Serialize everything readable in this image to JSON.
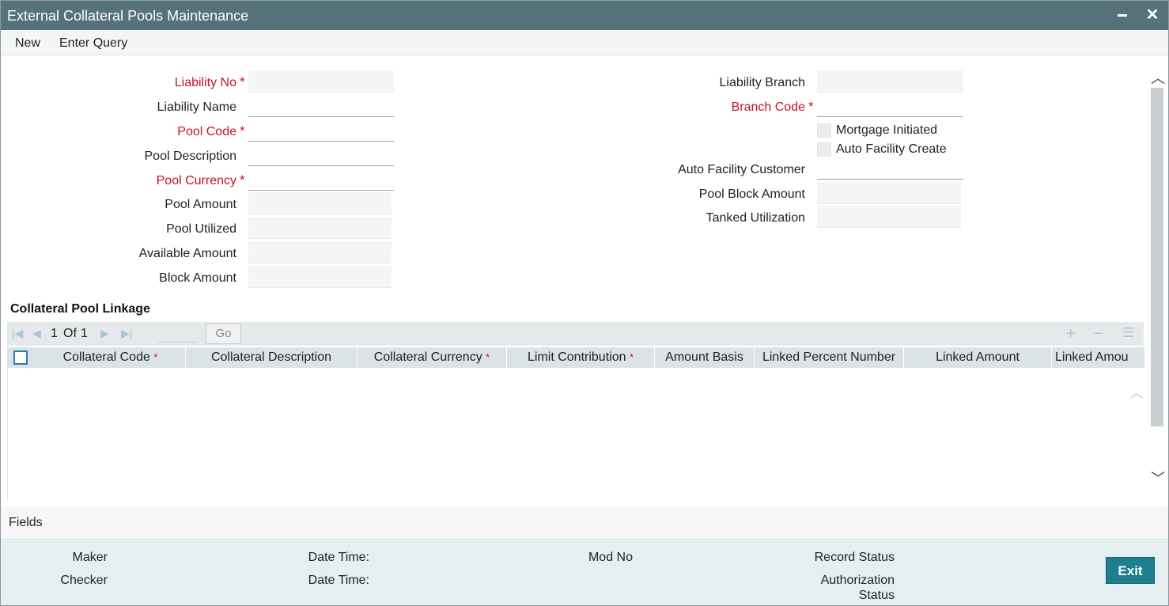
{
  "window": {
    "title": "External Collateral Pools Maintenance",
    "minimize_glyph": "▬",
    "close_glyph": "✕"
  },
  "menu": {
    "new_label": "New",
    "enter_query_label": "Enter Query"
  },
  "form": {
    "liability_no": {
      "label": "Liability No",
      "value": ""
    },
    "liability_name": {
      "label": "Liability Name",
      "value": ""
    },
    "pool_code": {
      "label": "Pool Code",
      "value": ""
    },
    "pool_description": {
      "label": "Pool Description",
      "value": ""
    },
    "pool_currency": {
      "label": "Pool Currency",
      "value": ""
    },
    "pool_amount": {
      "label": "Pool Amount",
      "value": ""
    },
    "pool_utilized": {
      "label": "Pool Utilized",
      "value": ""
    },
    "available_amount": {
      "label": "Available Amount",
      "value": ""
    },
    "block_amount": {
      "label": "Block Amount",
      "value": ""
    },
    "liability_branch": {
      "label": "Liability Branch",
      "value": ""
    },
    "branch_code": {
      "label": "Branch Code",
      "value": ""
    },
    "mortgage_initiated": {
      "label": "Mortgage Initiated",
      "checked": false
    },
    "auto_facility_create": {
      "label": "Auto Facility Create",
      "checked": false
    },
    "auto_facility_customer": {
      "label": "Auto Facility Customer",
      "value": ""
    },
    "pool_block_amount": {
      "label": "Pool Block Amount",
      "value": ""
    },
    "tanked_utilization": {
      "label": "Tanked Utilization",
      "value": ""
    },
    "required_marker": "*"
  },
  "linkage": {
    "section_title": "Collateral Pool Linkage",
    "pager": {
      "current": "1",
      "of_label": "Of",
      "total": "1",
      "go_label": "Go"
    },
    "columns": [
      "Collateral Code",
      "Collateral Description",
      "Collateral Currency",
      "Limit Contribution",
      "Amount Basis",
      "Linked Percent Number",
      "Linked Amount",
      "Linked Amou"
    ],
    "rows": []
  },
  "fields_bar": {
    "label": "Fields"
  },
  "footer": {
    "maker_label": "Maker",
    "checker_label": "Checker",
    "date_time_label_1": "Date Time:",
    "date_time_label_2": "Date Time:",
    "mod_no_label": "Mod No",
    "record_status_label": "Record Status",
    "authorization_label": "Authorization",
    "status_label": "Status",
    "exit_label": "Exit"
  },
  "colors": {
    "titlebar": "#55717a",
    "required": "#c8102e",
    "exit_button": "#1d7e8e",
    "footer_bg": "#e5eff2",
    "grid_header": "#dbe3e6"
  }
}
